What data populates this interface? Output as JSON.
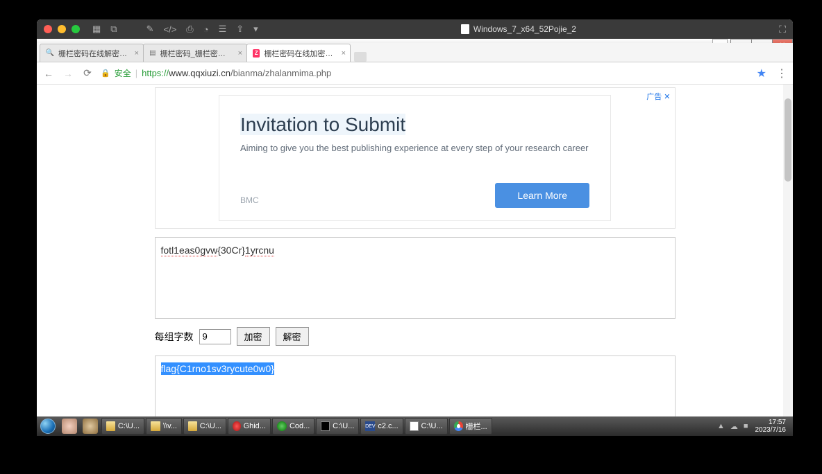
{
  "mac_titlebar": {
    "title": "Windows_7_x64_52Pojie_2"
  },
  "tabs": [
    {
      "label": "栅栏密码在线解密 - 搜索",
      "fav": "search"
    },
    {
      "label": "栅栏密码_栅栏密码在线…",
      "fav": "page"
    },
    {
      "label": "栅栏密码在线加密解密 -",
      "fav": "zl",
      "active": true
    }
  ],
  "address": {
    "secure_label": "安全",
    "proto": "https://",
    "host": "www.qqxiuzi.cn",
    "path": "/bianma/zhalanmima.php"
  },
  "ad": {
    "info": "广告 ✕",
    "title": "Invitation to Submit",
    "sub": "Aiming to give you the best publishing experience at every step of your research career",
    "brand": "BMC",
    "cta": "Learn More"
  },
  "input_cipher": {
    "parts": [
      "fotl1eas0gvw",
      "{30Cr}",
      "1yrcnu"
    ]
  },
  "controls": {
    "group_label": "每组字数",
    "group_value": "9",
    "encrypt_btn": "加密",
    "decrypt_btn": "解密"
  },
  "output_plain": "flag{C1rno1sv3rycute0w0}",
  "win_controls": {
    "min": "—",
    "max": "▭",
    "close": "✕"
  },
  "taskbar": {
    "items": [
      {
        "icon": "folder",
        "label": "C:\\U..."
      },
      {
        "icon": "folder",
        "label": "\\\\v..."
      },
      {
        "icon": "folder",
        "label": "C:\\U..."
      },
      {
        "icon": "ghidra",
        "label": "Ghid..."
      },
      {
        "icon": "code",
        "label": "Cod..."
      },
      {
        "icon": "cmd",
        "label": "C:\\U..."
      },
      {
        "icon": "dev",
        "label": "c2.c..."
      },
      {
        "icon": "np",
        "label": "C:\\U..."
      },
      {
        "icon": "chrome",
        "label": "栅栏..."
      }
    ],
    "time": "17:57",
    "date": "2023/7/16"
  }
}
